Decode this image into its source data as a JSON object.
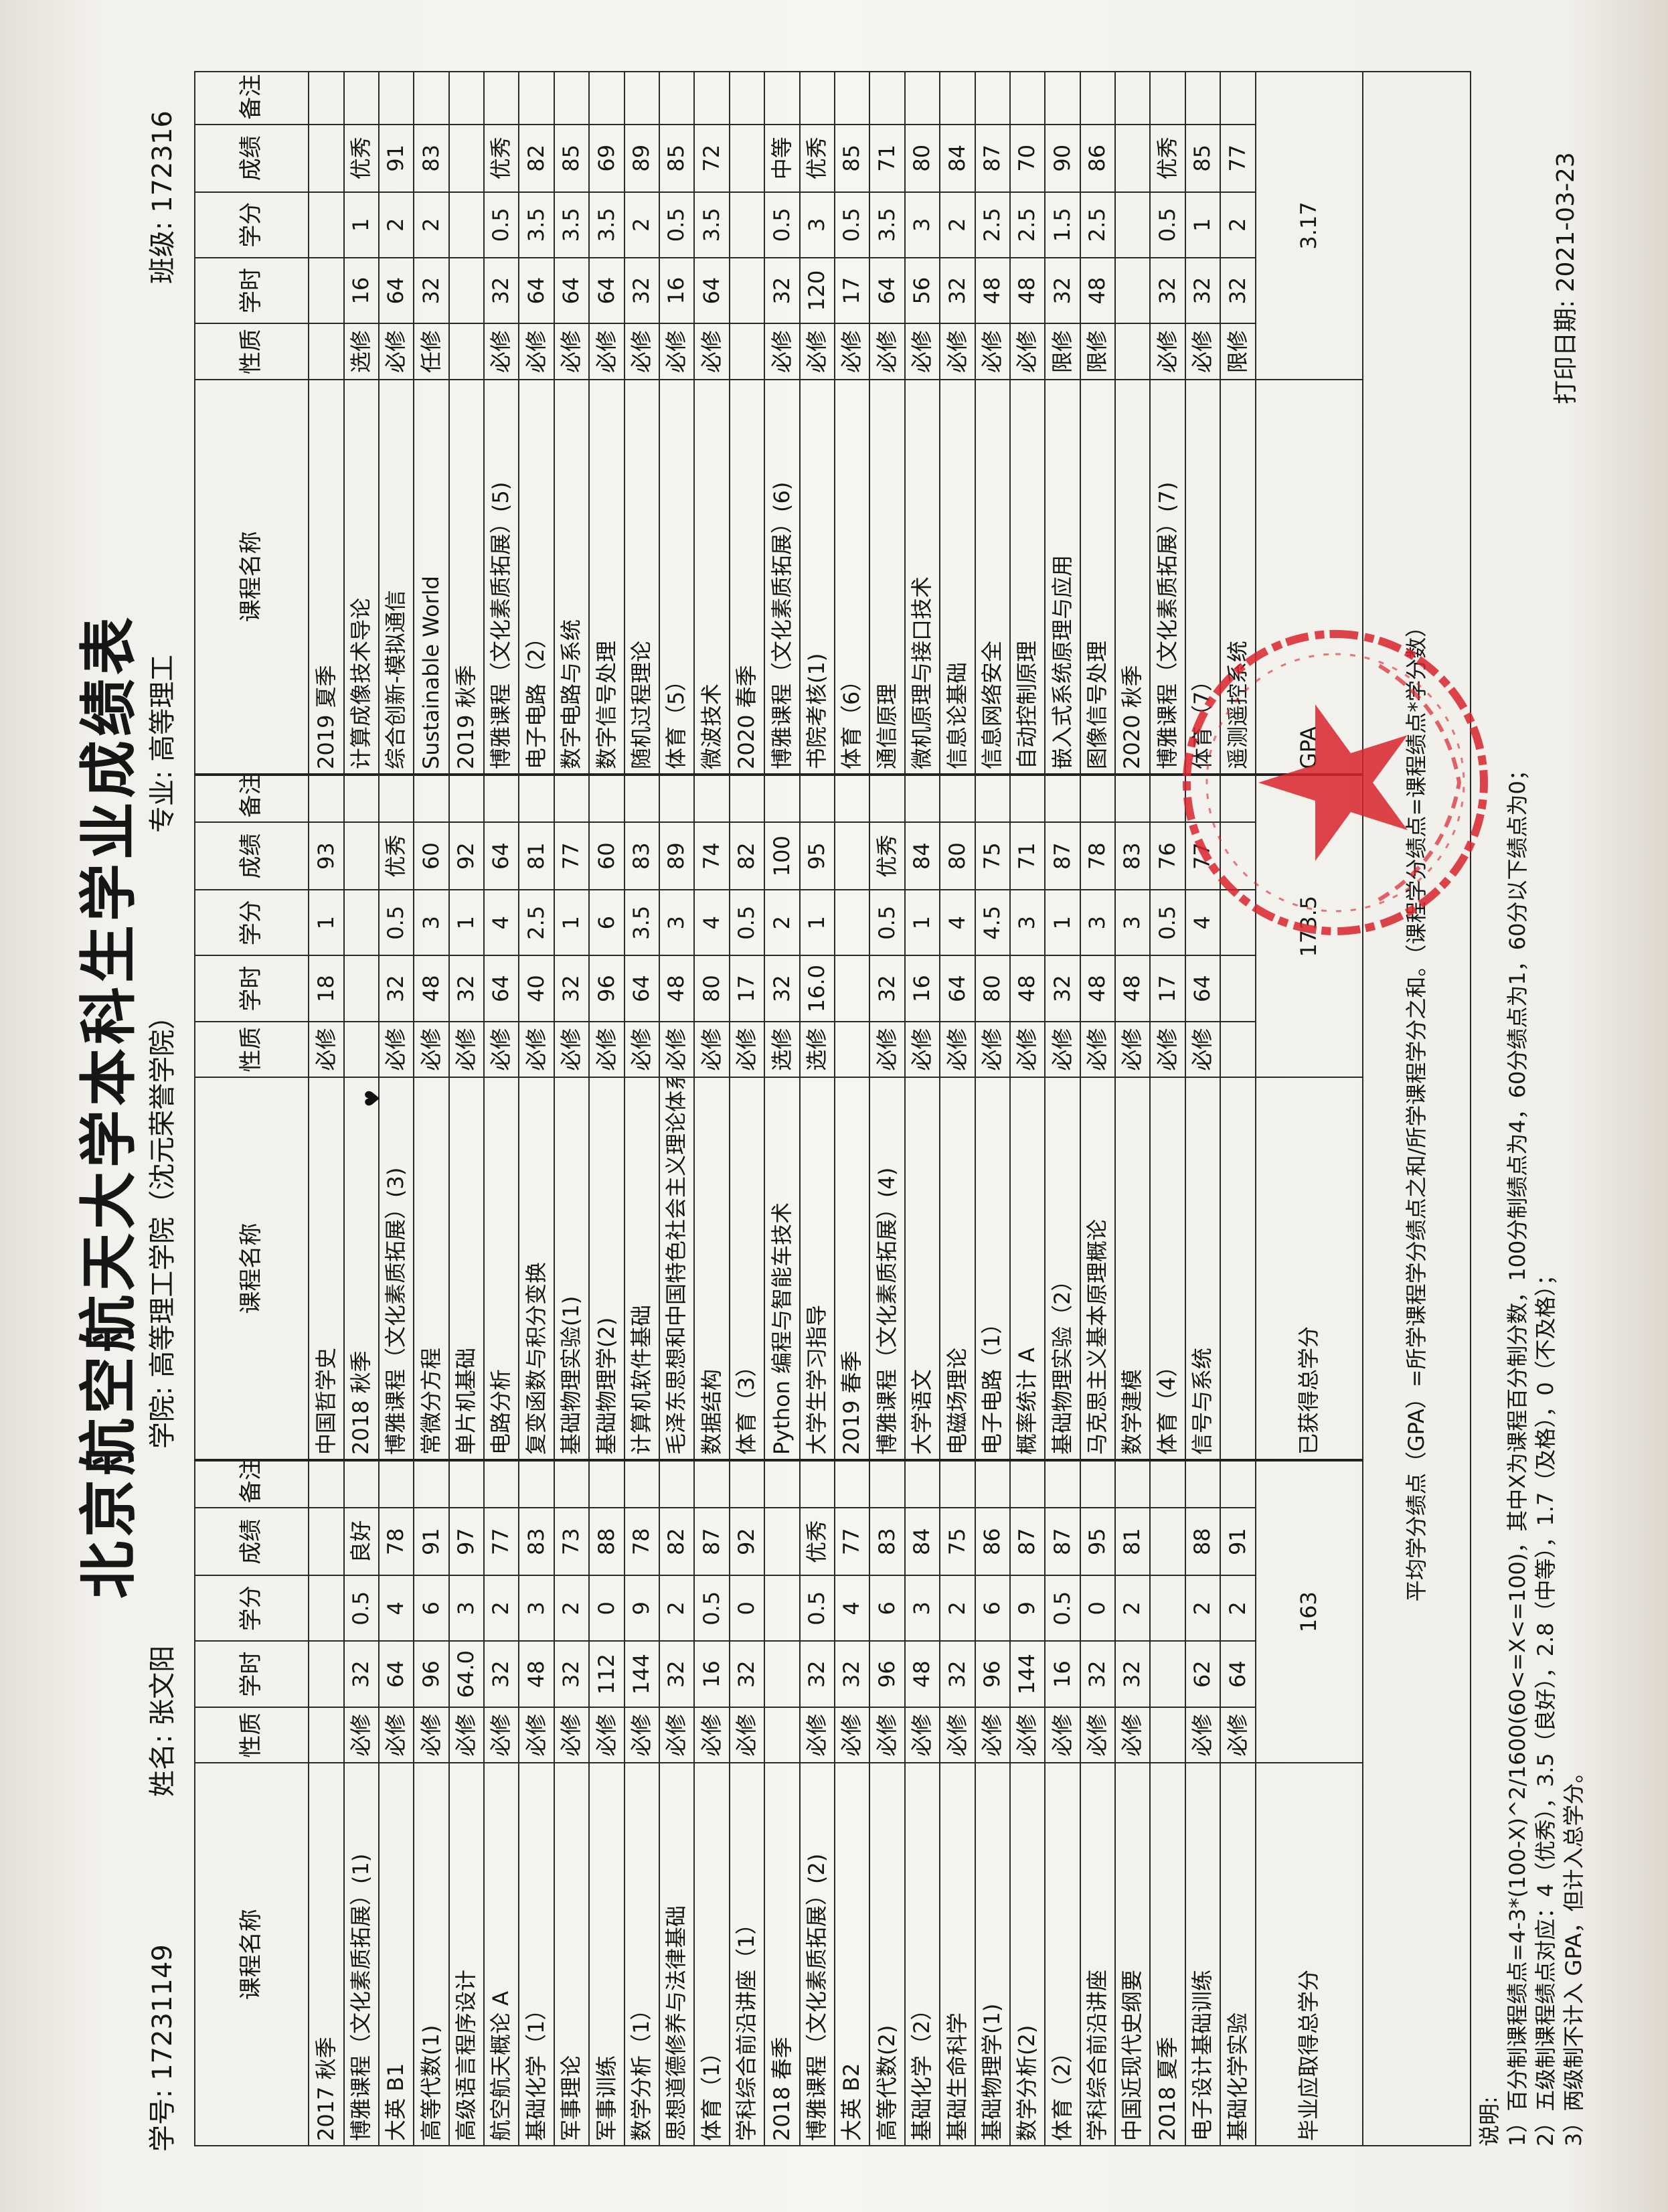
{
  "header": {
    "title": "北京航空航天大学本科生学业成绩表",
    "student_id": "学号: 17231149",
    "name": "姓名: 张文阳",
    "college": "学院: 高等理工学院（沈元荣誉学院）",
    "major": "专业: 高等理工",
    "class": "班级: 172316"
  },
  "table": {
    "columns": [
      "课程名称",
      "性质",
      "学时",
      "学分",
      "成绩",
      "备注"
    ],
    "column_groups": [
      {
        "rows": [
          {
            "name": "2017 秋季",
            "term": true
          },
          {
            "name": "博雅课程（文化素质拓展）(1)",
            "type": "必修",
            "hours": "32",
            "credits": "0.5",
            "grade": "良好"
          },
          {
            "name": "大英 B1",
            "type": "必修",
            "hours": "64",
            "credits": "4",
            "grade": "78"
          },
          {
            "name": "高等代数(1)",
            "type": "必修",
            "hours": "96",
            "credits": "6",
            "grade": "91"
          },
          {
            "name": "高级语言程序设计",
            "type": "必修",
            "hours": "64.0",
            "credits": "3",
            "grade": "97"
          },
          {
            "name": "航空航天概论 A",
            "type": "必修",
            "hours": "32",
            "credits": "2",
            "grade": "77"
          },
          {
            "name": "基础化学（1）",
            "type": "必修",
            "hours": "48",
            "credits": "3",
            "grade": "83"
          },
          {
            "name": "军事理论",
            "type": "必修",
            "hours": "32",
            "credits": "2",
            "grade": "73"
          },
          {
            "name": "军事训练",
            "type": "必修",
            "hours": "112",
            "credits": "0",
            "grade": "88"
          },
          {
            "name": "数学分析（1）",
            "type": "必修",
            "hours": "144",
            "credits": "9",
            "grade": "78"
          },
          {
            "name": "思想道德修养与法律基础",
            "type": "必修",
            "hours": "32",
            "credits": "2",
            "grade": "82"
          },
          {
            "name": "体育（1）",
            "type": "必修",
            "hours": "16",
            "credits": "0.5",
            "grade": "87"
          },
          {
            "name": "学科综合前沿讲座（1）",
            "type": "必修",
            "hours": "32",
            "credits": "0",
            "grade": "92"
          },
          {
            "name": "2018 春季",
            "term": true
          },
          {
            "name": "博雅课程（文化素质拓展）(2)",
            "type": "必修",
            "hours": "32",
            "credits": "0.5",
            "grade": "优秀"
          },
          {
            "name": "大英 B2",
            "type": "必修",
            "hours": "32",
            "credits": "4",
            "grade": "77"
          },
          {
            "name": "高等代数(2)",
            "type": "必修",
            "hours": "96",
            "credits": "6",
            "grade": "83"
          },
          {
            "name": "基础化学（2）",
            "type": "必修",
            "hours": "48",
            "credits": "3",
            "grade": "84"
          },
          {
            "name": "基础生命科学",
            "type": "必修",
            "hours": "32",
            "credits": "2",
            "grade": "75"
          },
          {
            "name": "基础物理学(1)",
            "type": "必修",
            "hours": "96",
            "credits": "6",
            "grade": "86"
          },
          {
            "name": "数学分析(2)",
            "type": "必修",
            "hours": "144",
            "credits": "9",
            "grade": "87"
          },
          {
            "name": "体育（2）",
            "type": "必修",
            "hours": "16",
            "credits": "0.5",
            "grade": "87"
          },
          {
            "name": "学科综合前沿讲座",
            "type": "必修",
            "hours": "32",
            "credits": "0",
            "grade": "95"
          },
          {
            "name": "中国近现代史纲要",
            "type": "必修",
            "hours": "32",
            "credits": "2",
            "grade": "81"
          },
          {
            "name": "2018 夏季",
            "term": true
          },
          {
            "name": "电子设计基础训练",
            "type": "必修",
            "hours": "62",
            "credits": "2",
            "grade": "88"
          },
          {
            "name": "基础化学实验",
            "type": "必修",
            "hours": "64",
            "credits": "2",
            "grade": "91"
          }
        ],
        "footer_label": "毕业应取得总学分",
        "footer_value": "163"
      },
      {
        "rows": [
          {
            "name": "中国哲学史",
            "type": "必修",
            "hours": "18",
            "credits": "1",
            "grade": "93"
          },
          {
            "name": "2018 秋季",
            "term": true
          },
          {
            "name": "博雅课程（文化素质拓展）(3)",
            "type": "必修",
            "hours": "32",
            "credits": "0.5",
            "grade": "优秀"
          },
          {
            "name": "常微分方程",
            "type": "必修",
            "hours": "48",
            "credits": "3",
            "grade": "60"
          },
          {
            "name": "单片机基础",
            "type": "必修",
            "hours": "32",
            "credits": "1",
            "grade": "92"
          },
          {
            "name": "电路分析",
            "type": "必修",
            "hours": "64",
            "credits": "4",
            "grade": "64"
          },
          {
            "name": "复变函数与积分变换",
            "type": "必修",
            "hours": "40",
            "credits": "2.5",
            "grade": "81"
          },
          {
            "name": "基础物理实验(1)",
            "type": "必修",
            "hours": "32",
            "credits": "1",
            "grade": "77"
          },
          {
            "name": "基础物理学(2)",
            "type": "必修",
            "hours": "96",
            "credits": "6",
            "grade": "60"
          },
          {
            "name": "计算机软件基础",
            "type": "必修",
            "hours": "64",
            "credits": "3.5",
            "grade": "83"
          },
          {
            "name": "毛泽东思想和中国特色社会主义理论体系概论",
            "type": "必修",
            "hours": "48",
            "credits": "3",
            "grade": "89"
          },
          {
            "name": "数据结构",
            "type": "必修",
            "hours": "80",
            "credits": "4",
            "grade": "74"
          },
          {
            "name": "体育（3）",
            "type": "必修",
            "hours": "17",
            "credits": "0.5",
            "grade": "82"
          },
          {
            "name": "Python 编程与智能车技术",
            "type": "选修",
            "hours": "32",
            "credits": "2",
            "grade": "100"
          },
          {
            "name": "大学生学习指导",
            "type": "选修",
            "hours": "16.0",
            "credits": "1",
            "grade": "95"
          },
          {
            "name": "2019 春季",
            "term": true
          },
          {
            "name": "博雅课程（文化素质拓展）(4)",
            "type": "必修",
            "hours": "32",
            "credits": "0.5",
            "grade": "优秀"
          },
          {
            "name": "大学语文",
            "type": "必修",
            "hours": "16",
            "credits": "1",
            "grade": "84"
          },
          {
            "name": "电磁场理论",
            "type": "必修",
            "hours": "64",
            "credits": "4",
            "grade": "80"
          },
          {
            "name": "电子电路（1）",
            "type": "必修",
            "hours": "80",
            "credits": "4.5",
            "grade": "75"
          },
          {
            "name": "概率统计 A",
            "type": "必修",
            "hours": "48",
            "credits": "3",
            "grade": "71"
          },
          {
            "name": "基础物理实验（2）",
            "type": "必修",
            "hours": "32",
            "credits": "1",
            "grade": "87"
          },
          {
            "name": "马克思主义基本原理概论",
            "type": "必修",
            "hours": "48",
            "credits": "3",
            "grade": "78"
          },
          {
            "name": "数学建模",
            "type": "必修",
            "hours": "48",
            "credits": "3",
            "grade": "83"
          },
          {
            "name": "体育（4）",
            "type": "必修",
            "hours": "17",
            "credits": "0.5",
            "grade": "76"
          },
          {
            "name": "信号与系统",
            "type": "必修",
            "hours": "64",
            "credits": "4",
            "grade": "77"
          }
        ],
        "footer_label": "已获得总学分",
        "footer_value": "173.5"
      },
      {
        "rows": [
          {
            "name": "2019 夏季",
            "term": true
          },
          {
            "name": "计算成像技术导论",
            "type": "选修",
            "hours": "16",
            "credits": "1",
            "grade": "优秀"
          },
          {
            "name": "综合创新-模拟通信",
            "type": "必修",
            "hours": "64",
            "credits": "2",
            "grade": "91"
          },
          {
            "name": "Sustainable World",
            "type": "任修",
            "hours": "32",
            "credits": "2",
            "grade": "83"
          },
          {
            "name": "2019 秋季",
            "term": true
          },
          {
            "name": "博雅课程（文化素质拓展）(5)",
            "type": "必修",
            "hours": "32",
            "credits": "0.5",
            "grade": "优秀"
          },
          {
            "name": "电子电路（2）",
            "type": "必修",
            "hours": "64",
            "credits": "3.5",
            "grade": "82"
          },
          {
            "name": "数字电路与系统",
            "type": "必修",
            "hours": "64",
            "credits": "3.5",
            "grade": "85"
          },
          {
            "name": "数字信号处理",
            "type": "必修",
            "hours": "64",
            "credits": "3.5",
            "grade": "69"
          },
          {
            "name": "随机过程理论",
            "type": "必修",
            "hours": "32",
            "credits": "2",
            "grade": "89"
          },
          {
            "name": "体育（5）",
            "type": "必修",
            "hours": "16",
            "credits": "0.5",
            "grade": "85"
          },
          {
            "name": "微波技术",
            "type": "必修",
            "hours": "64",
            "credits": "3.5",
            "grade": "72"
          },
          {
            "name": "2020 春季",
            "term": true
          },
          {
            "name": "博雅课程（文化素质拓展）(6)",
            "type": "必修",
            "hours": "32",
            "credits": "0.5",
            "grade": "中等"
          },
          {
            "name": "书院考核(1)",
            "type": "必修",
            "hours": "120",
            "credits": "3",
            "grade": "优秀"
          },
          {
            "name": "体育（6）",
            "type": "必修",
            "hours": "17",
            "credits": "0.5",
            "grade": "85"
          },
          {
            "name": "通信原理",
            "type": "必修",
            "hours": "64",
            "credits": "3.5",
            "grade": "71"
          },
          {
            "name": "微机原理与接口技术",
            "type": "必修",
            "hours": "56",
            "credits": "3",
            "grade": "80"
          },
          {
            "name": "信息论基础",
            "type": "必修",
            "hours": "32",
            "credits": "2",
            "grade": "84"
          },
          {
            "name": "信息网络安全",
            "type": "必修",
            "hours": "48",
            "credits": "2.5",
            "grade": "87"
          },
          {
            "name": "自动控制原理",
            "type": "必修",
            "hours": "48",
            "credits": "2.5",
            "grade": "70"
          },
          {
            "name": "嵌入式系统原理与应用",
            "type": "限修",
            "hours": "32",
            "credits": "1.5",
            "grade": "90"
          },
          {
            "name": "图像信号处理",
            "type": "限修",
            "hours": "48",
            "credits": "2.5",
            "grade": "86"
          },
          {
            "name": "2020 秋季",
            "term": true
          },
          {
            "name": "博雅课程（文化素质拓展）(7)",
            "type": "必修",
            "hours": "32",
            "credits": "0.5",
            "grade": "优秀"
          },
          {
            "name": "体育（7）",
            "type": "必修",
            "hours": "32",
            "credits": "1",
            "grade": "85"
          },
          {
            "name": "遥测遥控系统",
            "type": "限修",
            "hours": "32",
            "credits": "2",
            "grade": "77"
          }
        ],
        "footer_label": "GPA",
        "footer_value": "3.17"
      }
    ],
    "summary_row": "平均学分绩点（GPA）=所学课程学分绩点之和/所学课程学分之和。（课程学分绩点=课程绩点*学分数）"
  },
  "notes": {
    "heading": "说明:",
    "items": [
      "1）百分制课程绩点=4-3*(100-X)^2/1600(60<=X<=100)，其中X为课程百分制分数，100分制绩点为4，60分绩点为1，60分以下绩点为0；",
      "2）五级制课程绩点对应：4（优秀），3.5（良好），2.8（中等），1.7（及格），0（不及格）；",
      "3）两级制不计入 GPA，但计入总学分。"
    ]
  },
  "print_date": "打印日期: 2021-03-23",
  "colors": {
    "ink": "#161616",
    "seal": "#d8242c",
    "paper": "#f6f5f1"
  }
}
